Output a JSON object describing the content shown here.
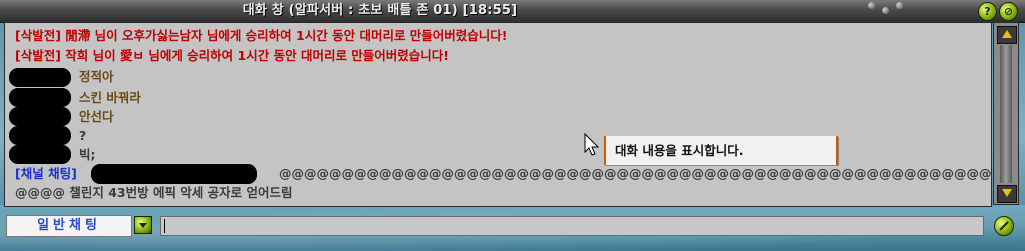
{
  "window": {
    "title": "대화 창 (알파서버 : 초보 배틀 존 01) [18:55]",
    "help_icon": "question-icon",
    "close_icon": "close-icon"
  },
  "chat": {
    "lines": [
      {
        "kind": "system",
        "text": "[삭발전] 閒滯 님이 오후가싫는남자 님에게 승리하여 1시간 동안 대머리로 만들어버렸습니다!"
      },
      {
        "kind": "system",
        "text": "[삭발전] 작희 님이 愛ㅂ 님에게 승리하여 1시간 동안 대머리로 만들어버렸습니다!"
      },
      {
        "kind": "user",
        "text": "정적아"
      },
      {
        "kind": "user",
        "text": "스킨 바꿔라"
      },
      {
        "kind": "user",
        "text": "안선다"
      },
      {
        "kind": "user",
        "text": "?"
      },
      {
        "kind": "user",
        "text": "빅;"
      },
      {
        "kind": "channel",
        "prefix": "[채널 채팅]",
        "text": "@@@@@@@@@@@@@@@@@@@@@@@@@@@@@@@@@@@@@@@@@@@@@@@@@@@@@@@@@@@@@"
      },
      {
        "kind": "channel_cont",
        "text": "@@@@ 챌린지 43번방 에픽 악세 공자로 얻어드림"
      }
    ],
    "tooltip": "대화 내용을 표시합니다."
  },
  "input": {
    "mode_label": "일반채팅",
    "value": ""
  }
}
